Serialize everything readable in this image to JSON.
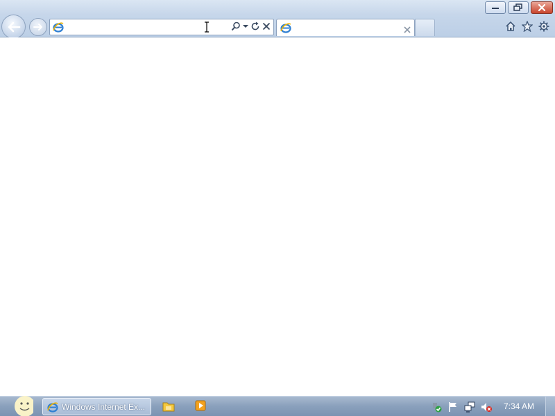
{
  "window": {
    "controls": [
      "minimize",
      "restore",
      "close"
    ]
  },
  "toolbar": {
    "back_icon": "back-arrow-icon",
    "forward_icon": "forward-arrow-icon",
    "address": {
      "value": "",
      "placeholder": "",
      "icons": [
        "ie-logo-icon",
        "search-icon",
        "dropdown-icon",
        "refresh-icon",
        "stop-icon"
      ]
    },
    "tab": {
      "title": "",
      "icon": "ie-logo-icon"
    },
    "right_icons": [
      "home-icon",
      "favorites-star-icon",
      "settings-gear-icon"
    ]
  },
  "taskbar": {
    "active_task": {
      "label": "Windows Internet Ex...",
      "icon": "ie-logo-icon"
    },
    "pinned": [
      "folder-icon",
      "media-player-icon"
    ],
    "tray_icons": [
      "security-shield-icon",
      "action-center-flag-icon",
      "network-icon",
      "speaker-muted-icon"
    ],
    "clock": "7:34 AM"
  },
  "colors": {
    "chrome": "#c6d6ea",
    "taskbar": "#8aa0bc",
    "close_button": "#c8452d"
  }
}
